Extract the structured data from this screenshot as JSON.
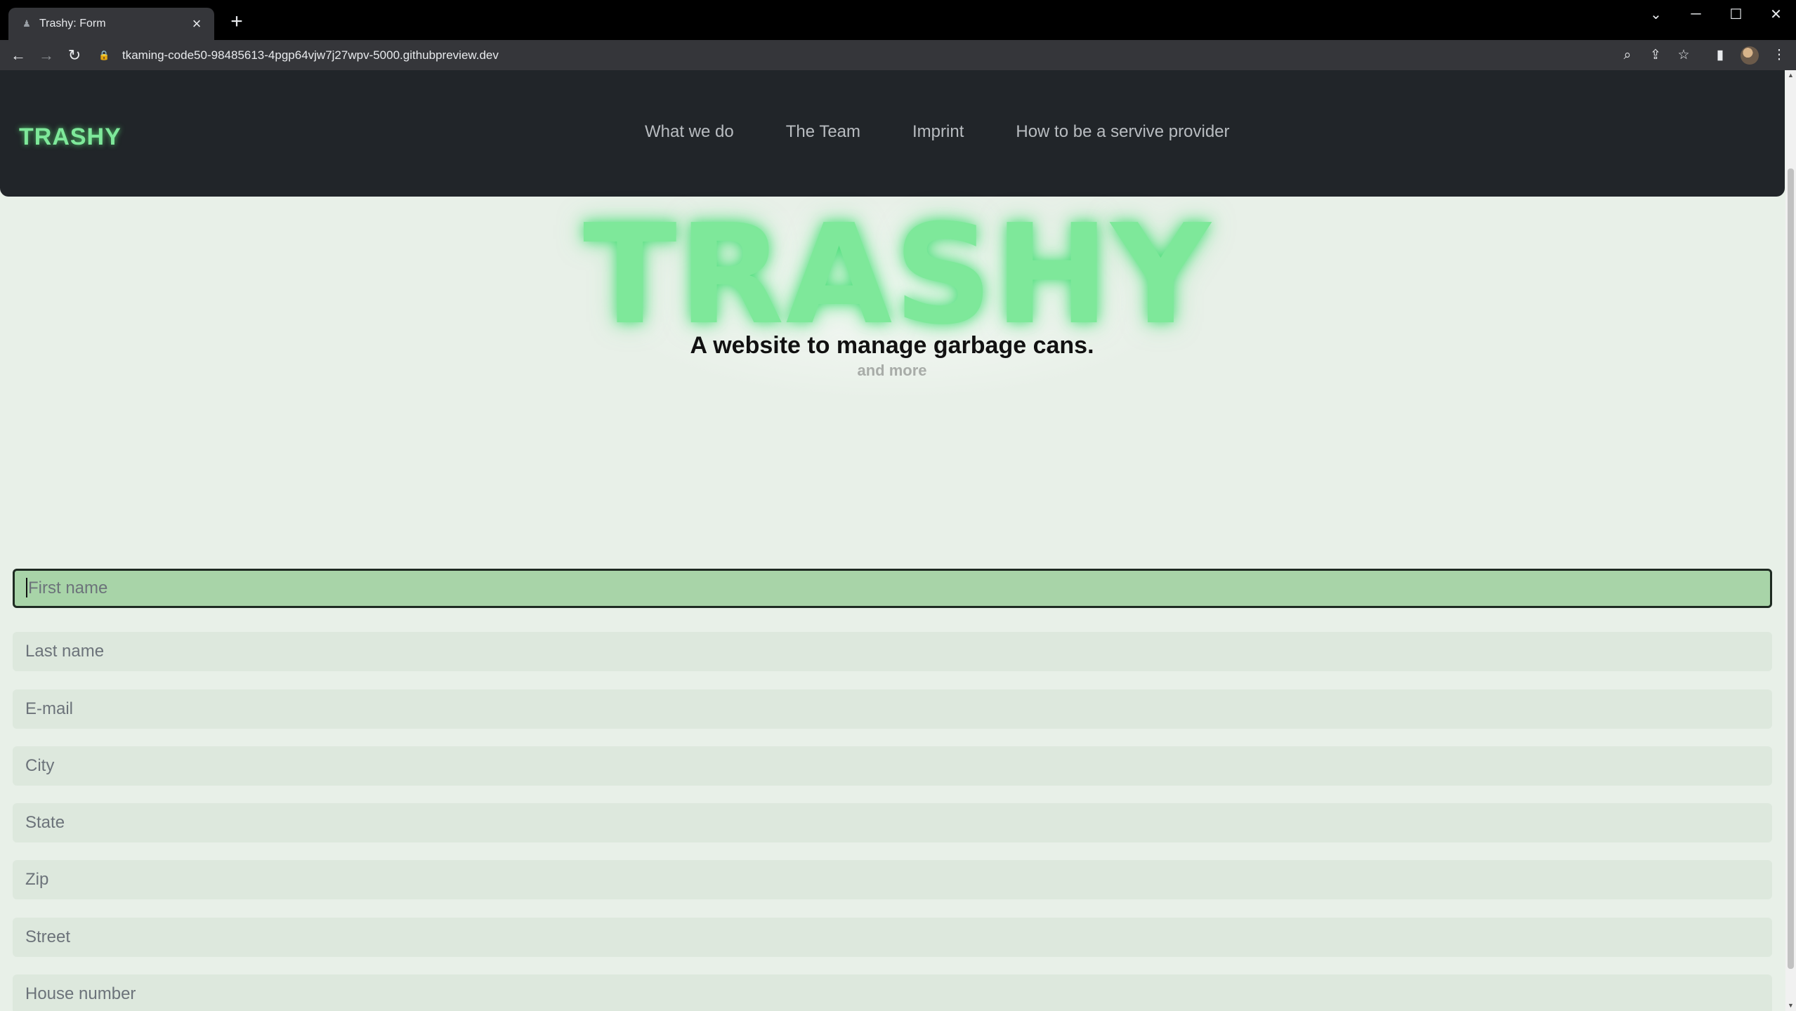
{
  "browser": {
    "tab_title": "Trashy: Form",
    "url": "tkaming-code50-98485613-4pgp64vjw7j27wpv-5000.githubpreview.dev",
    "icons": {
      "close": "close-icon",
      "new_tab": "plus-icon",
      "back": "arrow-left-icon",
      "forward": "arrow-right-icon",
      "reload": "reload-icon",
      "lock": "lock-icon",
      "zoom": "zoom-icon",
      "share": "share-icon",
      "bookmark": "star-icon",
      "side_panel": "side-panel-icon",
      "menu": "kebab-menu-icon"
    }
  },
  "site": {
    "brand": "TRASHY",
    "nav": [
      "What we do",
      "The Team",
      "Imprint",
      "How to be a servive provider"
    ],
    "hero": {
      "title": "TRASHY",
      "subtitle": "A website to manage garbage cans.",
      "tagline": "and more"
    },
    "form": {
      "fields": [
        {
          "placeholder": "First name",
          "focused": true
        },
        {
          "placeholder": "Last name"
        },
        {
          "placeholder": "E-mail"
        },
        {
          "placeholder": "City"
        },
        {
          "placeholder": "State"
        },
        {
          "placeholder": "Zip"
        },
        {
          "placeholder": "Street"
        },
        {
          "placeholder": "House number"
        }
      ]
    },
    "colors": {
      "navbar": "#212529",
      "brand_green": "#7ee89a",
      "page_bg": "#e8f0e8",
      "field_bg": "#dde8dd",
      "focused_field_bg": "#a8d4a8"
    }
  }
}
